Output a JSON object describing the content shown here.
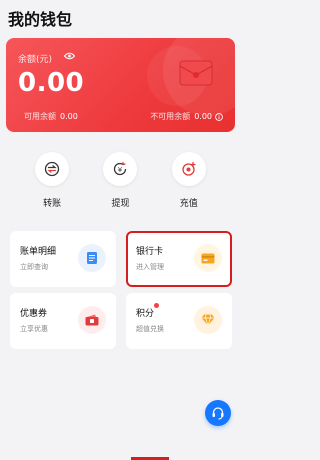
{
  "header": {
    "title": "我的钱包"
  },
  "balance_card": {
    "label": "余额(元)",
    "amount": "0.00",
    "available_label": "可用余额",
    "available_value": "0.00",
    "unavailable_label": "不可用余额",
    "unavailable_value": "0.00"
  },
  "quick_actions": [
    {
      "label": "转账",
      "icon": "transfer-icon"
    },
    {
      "label": "提现",
      "icon": "withdraw-icon"
    },
    {
      "label": "充值",
      "icon": "recharge-icon"
    }
  ],
  "tiles": [
    {
      "title": "账单明细",
      "subtitle": "立即查询",
      "icon": "bill-icon"
    },
    {
      "title": "银行卡",
      "subtitle": "进入管理",
      "icon": "bank-card-icon"
    },
    {
      "title": "优惠券",
      "subtitle": "立享优惠",
      "icon": "coupon-icon"
    },
    {
      "title": "积分",
      "subtitle": "超值兑换",
      "icon": "diamond-icon"
    }
  ],
  "colors": {
    "card_red": "#ee3a3d",
    "accent_blue": "#3b8cf6",
    "accent_red": "#f24343",
    "accent_orange": "#f5a623",
    "highlight": "#d21f1f"
  }
}
